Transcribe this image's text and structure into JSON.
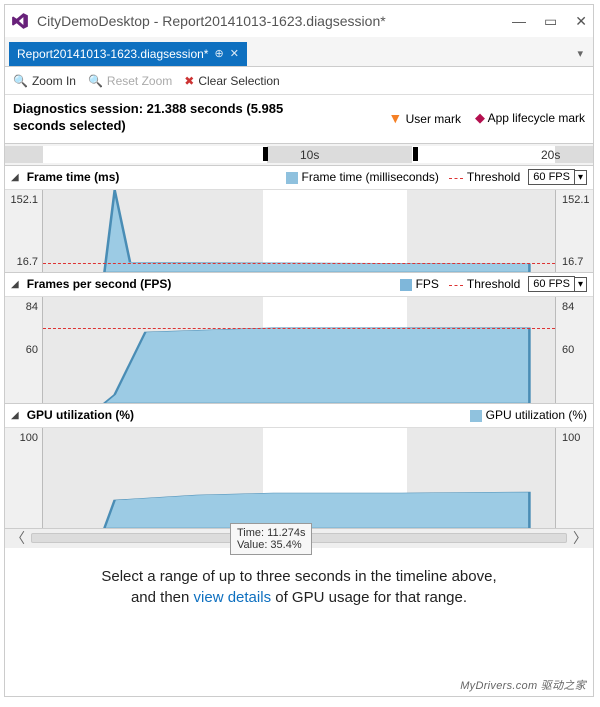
{
  "window": {
    "app": "CityDemoDesktop",
    "doc": "Report20141013-1623.diagsession*"
  },
  "tab": {
    "label": "Report20141013-1623.diagsession*"
  },
  "toolbar": {
    "zoom_in": "Zoom In",
    "reset_zoom": "Reset Zoom",
    "clear_selection": "Clear Selection"
  },
  "session": {
    "text": "Diagnostics session: 21.388 seconds (5.985 seconds selected)"
  },
  "legend_marks": {
    "user": "User mark",
    "lifecycle": "App lifecycle mark"
  },
  "ruler": {
    "t10": "10s",
    "t20": "20s"
  },
  "frame_time": {
    "title": "Frame time (ms)",
    "series_label": "Frame time (milliseconds)",
    "threshold_label": "Threshold",
    "fps_option": "60 FPS",
    "ymax": "152.1",
    "ymin": "16.7"
  },
  "fps": {
    "title": "Frames per second (FPS)",
    "series_label": "FPS",
    "threshold_label": "Threshold",
    "fps_option": "60 FPS",
    "ymax": "84",
    "ythresh": "60"
  },
  "gpu": {
    "title": "GPU utilization (%)",
    "series_label": "GPU utilization (%)",
    "ymax": "100"
  },
  "tooltip": {
    "time": "Time: 11.274s",
    "value": "Value: 35.4%"
  },
  "message": {
    "line1": "Select a range of up to three seconds in the timeline above,",
    "line2_a": "and then ",
    "link": "view details",
    "line2_b": " of GPU usage for that range."
  },
  "watermark": "MyDrivers.com 驱动之家",
  "chart_data": [
    {
      "type": "area",
      "name": "frame_time",
      "title": "Frame time (ms)",
      "xlabel": "seconds",
      "ylabel": "ms",
      "ylim": [
        0,
        152.1
      ],
      "x": [
        0,
        1,
        2,
        3,
        4,
        5,
        6,
        7,
        8,
        9,
        10,
        11,
        12,
        13,
        14,
        15,
        16,
        17,
        18,
        19,
        20,
        21.388
      ],
      "values": [
        0,
        0,
        0,
        152,
        18,
        18,
        18,
        17,
        17,
        17,
        17,
        17,
        17,
        17,
        17,
        17,
        17,
        17,
        17,
        17,
        0,
        0
      ],
      "threshold": 16.7
    },
    {
      "type": "area",
      "name": "fps",
      "title": "Frames per second (FPS)",
      "xlabel": "seconds",
      "ylabel": "FPS",
      "ylim": [
        0,
        84
      ],
      "x": [
        0,
        1,
        2,
        3,
        4,
        5,
        6,
        7,
        8,
        9,
        10,
        11,
        12,
        13,
        14,
        15,
        16,
        17,
        18,
        19,
        20,
        21.388
      ],
      "values": [
        0,
        0,
        0,
        8,
        55,
        58,
        60,
        60,
        60,
        60,
        60,
        60,
        60,
        60,
        60,
        60,
        60,
        60,
        60,
        60,
        0,
        0
      ],
      "threshold": 60
    },
    {
      "type": "area",
      "name": "gpu_utilization",
      "title": "GPU utilization (%)",
      "xlabel": "seconds",
      "ylabel": "%",
      "ylim": [
        0,
        100
      ],
      "x": [
        0,
        1,
        2,
        3,
        4,
        5,
        6,
        7,
        8,
        9,
        10,
        11,
        12,
        13,
        14,
        15,
        16,
        17,
        18,
        19,
        20,
        21.388
      ],
      "values": [
        0,
        0,
        0,
        30,
        32,
        34,
        35,
        36,
        36,
        36,
        35,
        35,
        36,
        36,
        36,
        36,
        36,
        36,
        36,
        36,
        0,
        0
      ]
    }
  ],
  "selection": {
    "start_s": 9.0,
    "end_s": 14.985
  }
}
